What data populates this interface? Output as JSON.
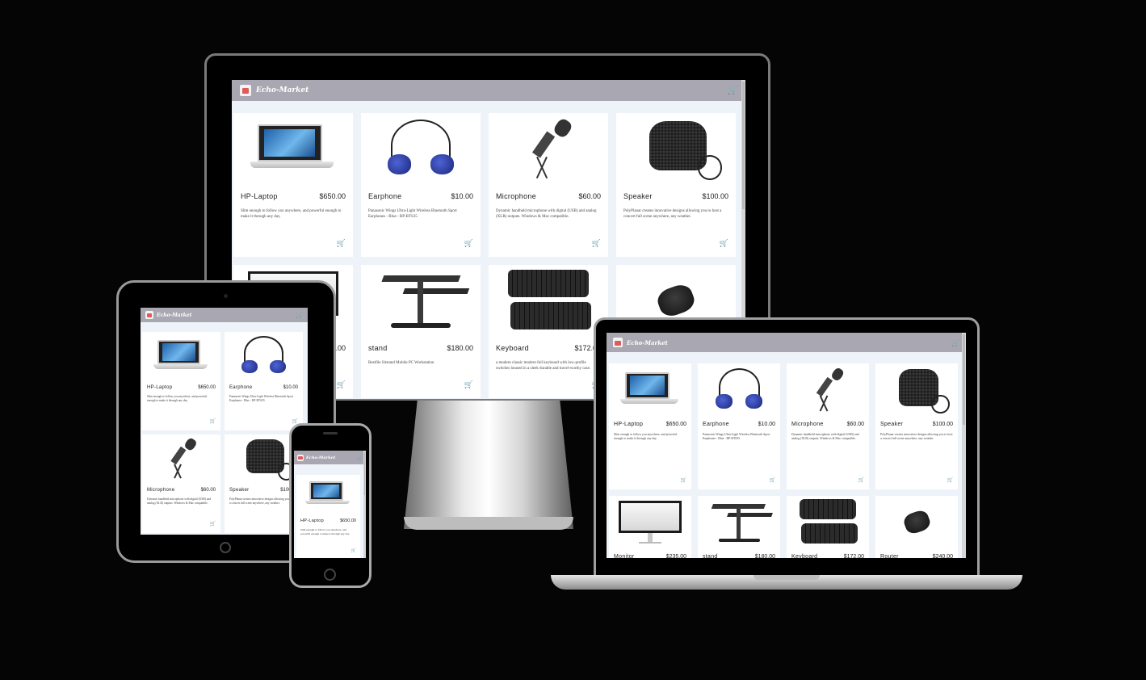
{
  "app": {
    "brand": "Echo-Market"
  },
  "products": [
    {
      "name": "HP-Laptop",
      "price": "$650.00",
      "desc": "Slim enough to follow you anywhere, and powerful enough to make it through any day.",
      "image": "laptop"
    },
    {
      "name": "Earphone",
      "price": "$10.00",
      "desc": "Panasonic Wings Ultra-Light Wireless Bluetooth Sport Earphones - Blue - RP-BTS35",
      "image": "earphone"
    },
    {
      "name": "Microphone",
      "price": "$60.00",
      "desc": "Dynamic handheld microphone with digital (USB) and analog (XLR) outputs. Windows & Mac compatible.",
      "image": "microphone"
    },
    {
      "name": "Speaker",
      "price": "$100.00",
      "desc": "PolyPlanar creates innovative designs allowing you to host a concert full scene anywhere, any weather.",
      "image": "speaker"
    },
    {
      "name": "Monitor",
      "price": "$235.00",
      "desc": "",
      "image": "monitor"
    },
    {
      "name": "stand",
      "price": "$180.00",
      "desc": "Bestfile Sitstand Mobile PC Workstation",
      "image": "stand"
    },
    {
      "name": "Keyboard",
      "price": "$172.00",
      "desc": "a modern classic modern full keyboard with low-profile switches housed in a sleek durable and travel-worthy case.",
      "image": "keyboard"
    },
    {
      "name": "Router",
      "price": "$240.00",
      "desc": "",
      "image": "router"
    }
  ]
}
